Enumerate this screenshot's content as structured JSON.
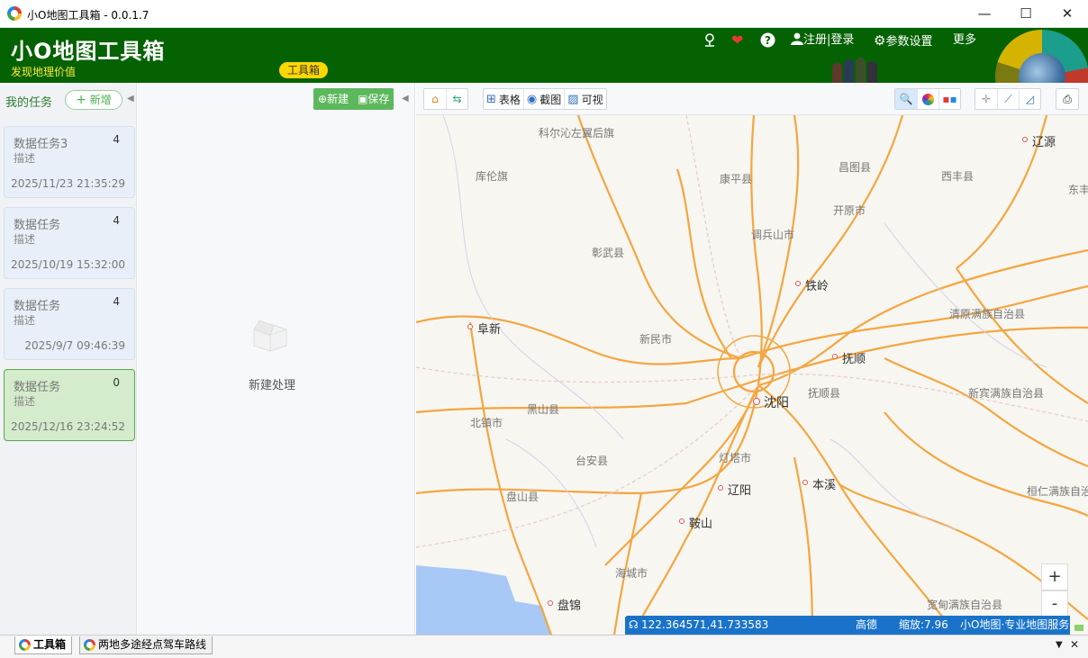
{
  "window": {
    "title": "小O地图工具箱 - 0.0.1.7",
    "minimize": "—",
    "maximize": "☐",
    "close": "✕"
  },
  "header": {
    "brand": "小O地图工具箱",
    "slogan": "发现地理价值",
    "badge": "工具箱",
    "register_login": "注册|登录",
    "settings": "参数设置",
    "more": "更多",
    "icons": [
      "map-pin-icon",
      "heart-icon",
      "help-icon",
      "user-icon",
      "gear-icon"
    ]
  },
  "tasks_panel": {
    "title": "我的任务",
    "add_label": "新增",
    "items": [
      {
        "name": "数据任务3",
        "count": "4",
        "desc": "描述",
        "time": "2025/11/23 21:35:29"
      },
      {
        "name": "数据任务",
        "count": "4",
        "desc": "描述",
        "time": "2025/10/19 15:32:00"
      },
      {
        "name": "数据任务",
        "count": "4",
        "desc": "描述",
        "time": "2025/9/7 09:46:39"
      },
      {
        "name": "数据任务",
        "count": "0",
        "desc": "描述",
        "time": "2025/12/16 23:24:52"
      }
    ]
  },
  "mid_panel": {
    "new_label": "新建",
    "save_label": "保存",
    "empty_label": "新建处理"
  },
  "map_toolbar": {
    "table": "表格",
    "screenshot": "截图",
    "visual": "可视"
  },
  "map": {
    "cities": [
      "辽源",
      "铁岭",
      "阜新",
      "抚顺",
      "沈阳",
      "本溪",
      "辽阳",
      "鞍山",
      "盘锦"
    ],
    "counties": [
      "科尔沁左翼后旗",
      "库伦旗",
      "康平县",
      "昌图县",
      "西丰县",
      "东丰",
      "开原市",
      "调兵山市",
      "彰武县",
      "清原满族自治县",
      "新民市",
      "抚顺县",
      "新宾满族自治县",
      "黑山县",
      "北镇市",
      "灯塔市",
      "台安县",
      "盘山县",
      "桓仁满族自治",
      "海城市",
      "宽甸满族自治县"
    ],
    "zoom_in": "+",
    "zoom_out": "-"
  },
  "status": {
    "coords": "122.364571,41.733583",
    "provider": "高德",
    "zoom": "缩放:7.96",
    "service": "小O地图·专业地图服务"
  },
  "bottom_tabs": [
    {
      "label": "工具箱"
    },
    {
      "label": "两地多途经点驾车路线"
    }
  ]
}
